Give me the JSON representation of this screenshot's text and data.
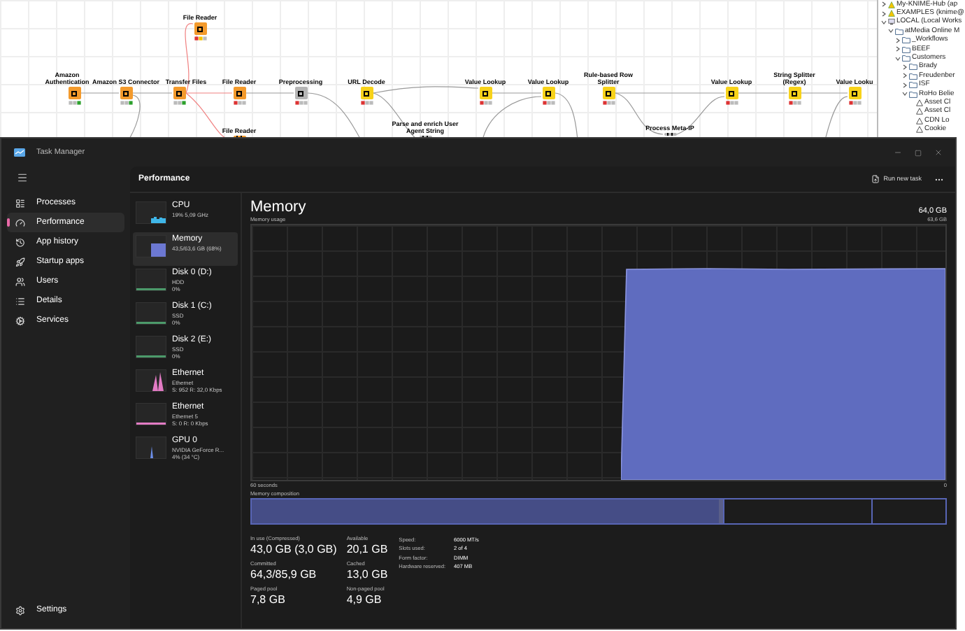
{
  "canvas": {
    "nodes": [
      {
        "label": "Amazon Authentication",
        "color": "#f39a2c",
        "kind": "executed"
      },
      {
        "label": "Amazon S3 Connector",
        "color": "#f39a2c",
        "kind": "executed"
      },
      {
        "label": "Transfer Files",
        "color": "#f39a2c",
        "kind": "executed"
      },
      {
        "label": "File Reader",
        "color": "#f39a2c",
        "kind": "warning"
      },
      {
        "label": "File Reader",
        "color": "#f39a2c",
        "kind": "failed"
      },
      {
        "label": "File Reader",
        "color": "#f39a2c",
        "kind": "hidden"
      },
      {
        "label": "Preprocessing",
        "color": "#b5b5b5",
        "kind": "idle"
      },
      {
        "label": "URL Decode",
        "color": "#f7d21a",
        "kind": "idle"
      },
      {
        "label": "Parse and enrich User Agent String",
        "color": "#b5b5b5",
        "kind": "hidden"
      },
      {
        "label": "Value Lookup",
        "color": "#f7d21a",
        "kind": "idle"
      },
      {
        "label": "Value Lookup",
        "color": "#f7d21a",
        "kind": "idle"
      },
      {
        "label": "Rule-based Row Splitter",
        "color": "#f7d21a",
        "kind": "idle"
      },
      {
        "label": "Process Meta-IP",
        "color": "#b5b5b5",
        "kind": "hidden"
      },
      {
        "label": "Value Lookup",
        "color": "#f7d21a",
        "kind": "idle"
      },
      {
        "label": "String Splitter (Regex)",
        "color": "#f7d21a",
        "kind": "idle"
      },
      {
        "label": "Value Looku",
        "color": "#f7d21a",
        "kind": "idle"
      }
    ]
  },
  "explorer": {
    "items": [
      {
        "label": "My-KNIME-Hub (ap",
        "kind": "hub",
        "expanded": false
      },
      {
        "label": "EXAMPLES (knime@",
        "kind": "hub",
        "expanded": false
      },
      {
        "label": "LOCAL (Local Works",
        "kind": "local",
        "expanded": true,
        "children": [
          {
            "label": "atMedia Online M",
            "kind": "folder",
            "expanded": true,
            "children": [
              {
                "label": "_Workflows",
                "kind": "folder",
                "expanded": false
              },
              {
                "label": "BEEF",
                "kind": "folder",
                "expanded": false
              },
              {
                "label": "Customers",
                "kind": "folder",
                "expanded": true,
                "children": [
                  {
                    "label": "Brady",
                    "kind": "folder",
                    "expanded": false
                  },
                  {
                    "label": "Freudenber",
                    "kind": "folder",
                    "expanded": false
                  },
                  {
                    "label": "ISF",
                    "kind": "folder",
                    "expanded": false
                  },
                  {
                    "label": "RoHo Belie",
                    "kind": "folder",
                    "expanded": true,
                    "children": [
                      {
                        "label": "Asset Cl",
                        "kind": "workflow"
                      },
                      {
                        "label": "Asset Cl",
                        "kind": "workflow"
                      },
                      {
                        "label": "CDN Lo",
                        "kind": "workflow"
                      },
                      {
                        "label": "Cookie",
                        "kind": "workflow"
                      }
                    ]
                  }
                ]
              }
            ]
          }
        ]
      }
    ]
  },
  "window": {
    "title": "Task Manager"
  },
  "nav": {
    "items": [
      {
        "label": "Processes",
        "selected": false
      },
      {
        "label": "Performance",
        "selected": true
      },
      {
        "label": "App history",
        "selected": false
      },
      {
        "label": "Startup apps",
        "selected": false
      },
      {
        "label": "Users",
        "selected": false
      },
      {
        "label": "Details",
        "selected": false
      },
      {
        "label": "Services",
        "selected": false
      }
    ],
    "settings": "Settings"
  },
  "header": {
    "title": "Performance",
    "run_new_task": "Run new task"
  },
  "devices": [
    {
      "name": "CPU",
      "lines": [
        "19% 5,09 GHz"
      ],
      "color": "#3fb6e8",
      "selected": false
    },
    {
      "name": "Memory",
      "lines": [
        "43,5/63,6 GB (68%)"
      ],
      "color": "#6c78d2",
      "selected": true
    },
    {
      "name": "Disk 0 (D:)",
      "lines": [
        "HDD",
        "0%"
      ],
      "color": "#4c9a6a",
      "selected": false
    },
    {
      "name": "Disk 1 (C:)",
      "lines": [
        "SSD",
        "0%"
      ],
      "color": "#4c9a6a",
      "selected": false
    },
    {
      "name": "Disk 2 (E:)",
      "lines": [
        "SSD",
        "0%"
      ],
      "color": "#4c9a6a",
      "selected": false
    },
    {
      "name": "Ethernet",
      "lines": [
        "Ethernet",
        "S: 952 R: 32,0 Kbps"
      ],
      "color": "#e27bc4",
      "selected": false
    },
    {
      "name": "Ethernet",
      "lines": [
        "Ethernet 5",
        "S: 0 R: 0 Kbps"
      ],
      "color": "#e27bc4",
      "selected": false
    },
    {
      "name": "GPU 0",
      "lines": [
        "NVIDIA GeForce R...",
        "4% (34 °C)"
      ],
      "color": "#6c8ee8",
      "selected": false
    }
  ],
  "memory": {
    "title": "Memory",
    "total": "64,0 GB",
    "usage_label": "Memory usage",
    "max": "63,6 GB",
    "time_label": "60 seconds",
    "min": "0",
    "composition_label": "Memory composition",
    "level": 0.68,
    "stats": [
      {
        "label": "In use (Compressed)",
        "value": "43,0 GB (3,0 GB)"
      },
      {
        "label": "Available",
        "value": "20,1 GB"
      },
      {
        "label": "Committed",
        "value": "64,3/85,9 GB"
      },
      {
        "label": "Cached",
        "value": "13,0 GB"
      },
      {
        "label": "Paged pool",
        "value": "7,8 GB"
      },
      {
        "label": "Non-paged pool",
        "value": "4,9 GB"
      }
    ],
    "specs": [
      {
        "label": "Speed:",
        "value": "6000 MT/s"
      },
      {
        "label": "Slots used:",
        "value": "2 of 4"
      },
      {
        "label": "Form factor:",
        "value": "DIMM"
      },
      {
        "label": "Hardware reserved:",
        "value": "407 MB"
      }
    ]
  }
}
